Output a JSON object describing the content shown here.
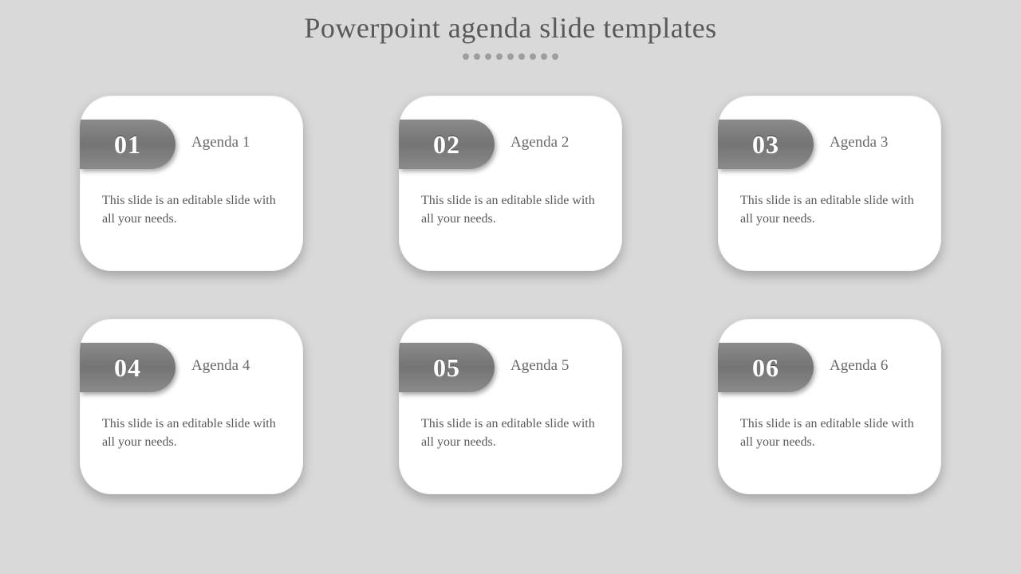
{
  "title": "Powerpoint agenda slide templates",
  "dot_count": 9,
  "cards": [
    {
      "num": "01",
      "label": "Agenda 1",
      "desc": "This slide is an editable slide with all your needs."
    },
    {
      "num": "02",
      "label": "Agenda 2",
      "desc": "This slide is an editable slide with all your needs."
    },
    {
      "num": "03",
      "label": "Agenda 3",
      "desc": "This slide is an editable slide with all your needs."
    },
    {
      "num": "04",
      "label": "Agenda 4",
      "desc": "This slide is an editable slide with all your needs."
    },
    {
      "num": "05",
      "label": "Agenda 5",
      "desc": "This slide is an editable slide with all your needs."
    },
    {
      "num": "06",
      "label": "Agenda 6",
      "desc": "This slide is an editable slide with all your needs."
    }
  ]
}
